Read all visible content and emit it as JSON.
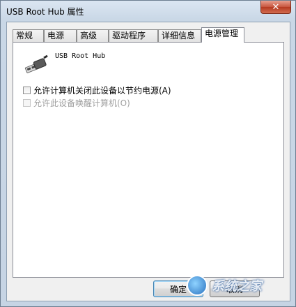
{
  "window": {
    "title": "USB Root Hub 属性",
    "close_glyph": "✕"
  },
  "tabs": [
    {
      "label": "常规"
    },
    {
      "label": "电源"
    },
    {
      "label": "高级"
    },
    {
      "label": "驱动程序"
    },
    {
      "label": "详细信息"
    },
    {
      "label": "电源管理",
      "active": true
    }
  ],
  "device": {
    "name": "USB Root Hub",
    "icon": "usb-plug-icon"
  },
  "options": {
    "allow_turn_off": {
      "label": "允许计算机关闭此设备以节约电源(A)",
      "checked": false,
      "enabled": true
    },
    "allow_wake": {
      "label": "允许此设备唤醒计算机(O)",
      "checked": false,
      "enabled": false
    }
  },
  "buttons": {
    "ok": "确定",
    "cancel": "取消"
  },
  "watermark": {
    "text": "系统之家",
    "icon": "watermark-logo-icon"
  }
}
